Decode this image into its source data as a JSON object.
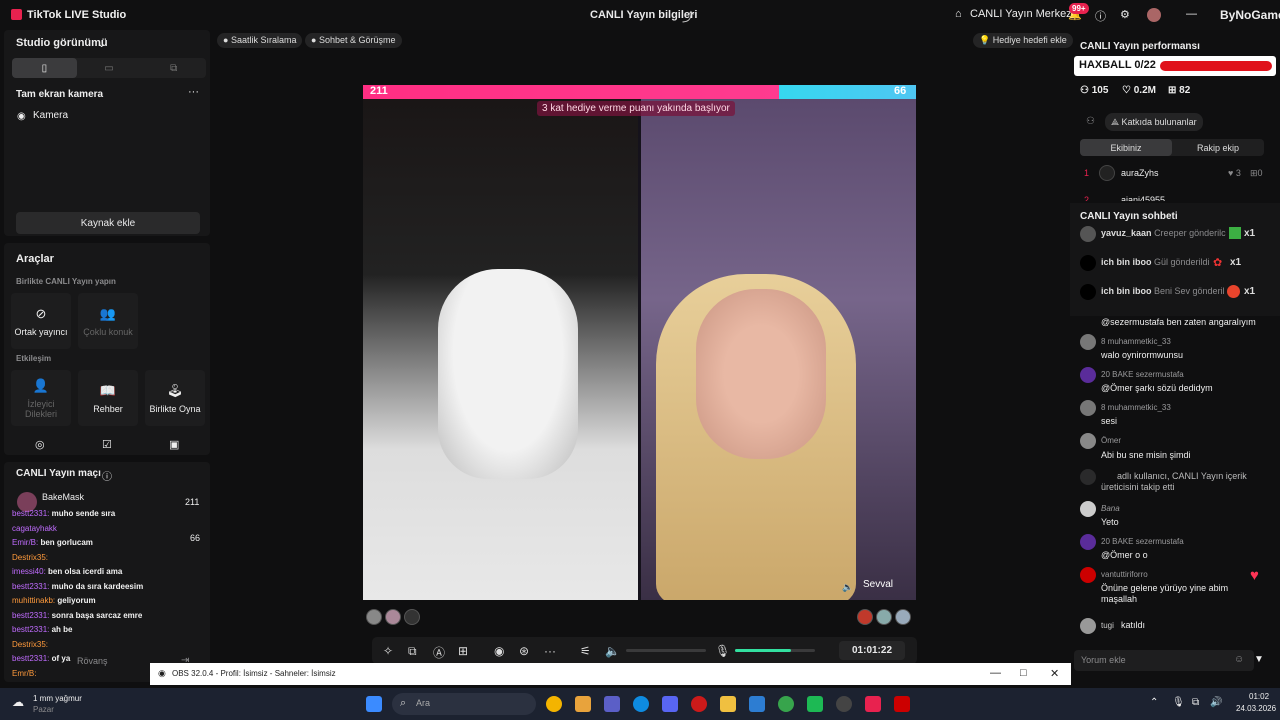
{
  "titlebar": {
    "app_name": "TikTok LIVE Studio",
    "center_title": "CANLI Yayın bilgileri",
    "live_center": "CANLI Yayın Merkezi",
    "notif_badge": "99+",
    "brand": "ByNoGame"
  },
  "left": {
    "studio_view": "Studio görünümü",
    "fullscreen_camera": "Tam ekran kamera",
    "camera": "Kamera",
    "add_source": "Kaynak ekle",
    "tools_title": "Araçlar",
    "together_live": "Birlikte CANLI Yayın yapın",
    "co_host": "Ortak yayıncı",
    "multi_guest": "Çoklu konuk",
    "interaction": "Etkileşim",
    "viewer_requests": "İzleyici Dilekleri",
    "guide": "Rehber",
    "play_together": "Birlikte Oyna",
    "match_title": "CANLI Yayın maçı",
    "match_players": [
      {
        "name": "BakeMask",
        "score": "211"
      },
      {
        "name": "",
        "score": "66"
      }
    ],
    "chat": [
      {
        "user": "bestt2331:",
        "msg": "muho sende sıra"
      },
      {
        "user": "cagatayhakk",
        "msg": ""
      },
      {
        "user": "Emir/B:",
        "msg": "ben gorlucam"
      },
      {
        "user": "Destrix35:",
        "msg": ""
      },
      {
        "user": "imessi40:",
        "msg": "ben olsa icerdi ama"
      },
      {
        "user": "bestt2331:",
        "msg": "muho da sıra kardeesim"
      },
      {
        "user": "muhittinakb:",
        "msg": "geliyorum"
      },
      {
        "user": "bestt2331:",
        "msg": "sonra başa sarcaz emre"
      },
      {
        "user": "bestt2331:",
        "msg": "ah be"
      },
      {
        "user": "Destrix35:",
        "msg": ""
      },
      {
        "user": "bestt2331:",
        "msg": "of ya"
      },
      {
        "user": "Emr/B:",
        "msg": ""
      }
    ],
    "rovans": "Rövanş"
  },
  "chips": {
    "hourly_rank": "Saatlik Sıralama",
    "chat_meet": "Sohbet & Görüşme",
    "gift_goal": "Hediye hedefi ekle"
  },
  "battle": {
    "left_score": "211",
    "right_score": "66",
    "notice": "3 kat hediye verme puanı yakında başlıyor",
    "guest_name": "Sevval",
    "timer": "01:01:22"
  },
  "right": {
    "perf_title": "CANLI Yayın performansı",
    "haxball": "HAXBALL 0/22",
    "stats": {
      "viewers": "105",
      "likes": "0.2M",
      "gifts": "82"
    },
    "contributors": "Katkıda bulunanlar",
    "tab_team": "Ekibiniz",
    "tab_rival": "Rakip ekip",
    "rank": [
      {
        "pos": "1",
        "name": "auraZyhs",
        "likes": "3",
        "gifts": "0"
      },
      {
        "pos": "2",
        "name": "aiani45955",
        "likes": "",
        "gifts": ""
      }
    ],
    "chat_title": "CANLI Yayın sohbeti",
    "gifts": [
      {
        "user": "yavuz_kaan",
        "text": "Creeper gönderilc",
        "count": "x1"
      },
      {
        "user": "ich bin iboo",
        "text": "Gül gönderildi",
        "count": "x1"
      },
      {
        "user": "ich bin iboo",
        "text": "Beni Sev gönderil",
        "count": "x1"
      }
    ],
    "messages": [
      {
        "name": "",
        "text": "@sezermustafa ben zaten angaralıyım"
      },
      {
        "name": "8  muhammetkic_33",
        "text": "walo oynirormwunsu"
      },
      {
        "name": "20  BAKE  sezermustafa",
        "text": "@Ömer şarkı sözü dedidym"
      },
      {
        "name": "8  muhammetkic_33",
        "text": "sesi"
      },
      {
        "name": "Ömer",
        "text": "Abi bu sne misin şimdi"
      },
      {
        "name": "",
        "text": "adlı kullanıcı, CANLI Yayın içerik üreticisini takip etti"
      },
      {
        "name": "Bana",
        "text": "Yeto"
      },
      {
        "name": "20  BAKE  sezermustafa",
        "text": "@Ömer o o"
      },
      {
        "name": "vantuttiriforro",
        "text": "Önüne gelene yürüyo yine abim maşallah"
      },
      {
        "name": "tugi",
        "text": "katıldı"
      }
    ],
    "comment_placeholder": "Yorum ekle"
  },
  "obs": {
    "title": "OBS 32.0.4 - Profil: İsimsiz - Sahneler: İsimsiz"
  },
  "taskbar": {
    "weather": "1 mm yağmur",
    "weather_sub": "Pazar",
    "search": "Ara",
    "time": "01:02",
    "date": "24.03.2026"
  }
}
